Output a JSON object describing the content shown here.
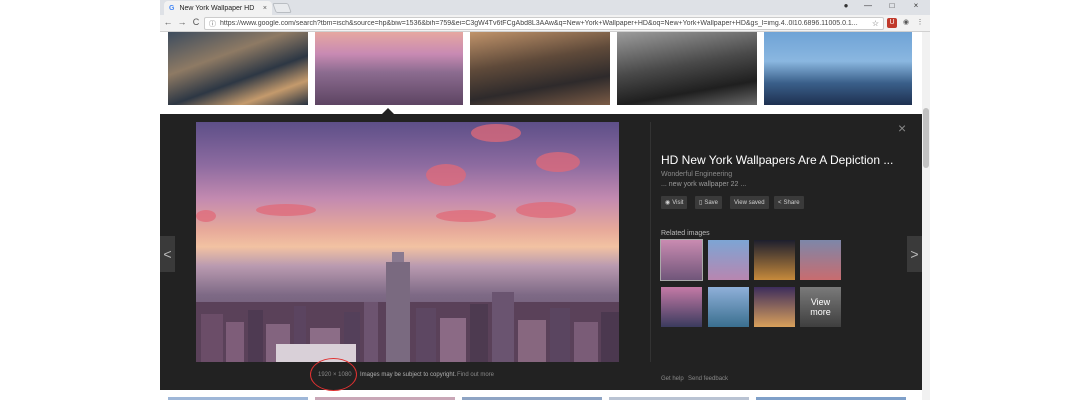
{
  "browser": {
    "tab_title": "New York Wallpaper HD",
    "tab_favicon": "G",
    "tab_close": "×",
    "window_controls": [
      "—",
      "□",
      "×"
    ],
    "nav": {
      "back": "←",
      "forward": "→",
      "reload": "C"
    },
    "url": "https://www.google.com/search?tbm=isch&source=hp&biw=1536&bih=759&ei=C3gW4Tv6tFCgAbd8L3AAw&q=New+York+Wallpaper+HD&oq=New+York+Wallpaper+HD&gs_l=img.4..0l10.6896.11005.0.1...",
    "info_icon": "ⓘ",
    "star_icon": "☆",
    "extensions": [
      "U",
      "◉",
      "⋮"
    ]
  },
  "viewer": {
    "title": "HD New York Wallpapers Are A Depiction ...",
    "source": "Wonderful Engineering",
    "caption": "... new york wallpaper 22 ...",
    "actions": [
      {
        "icon": "◉",
        "label": "Visit"
      },
      {
        "icon": "▯",
        "label": "Save"
      },
      {
        "icon": "",
        "label": "View saved"
      },
      {
        "icon": "<",
        "label": "Share"
      }
    ],
    "related_label": "Related images",
    "view_more": "View more",
    "image_size": "1920 × 1080",
    "copyright_note": "Images may be subject to copyright.",
    "find_out_more": "Find out more",
    "help_link": "Get help",
    "feedback_link": "Send feedback",
    "close": "×",
    "prev": "<",
    "next": ">"
  }
}
